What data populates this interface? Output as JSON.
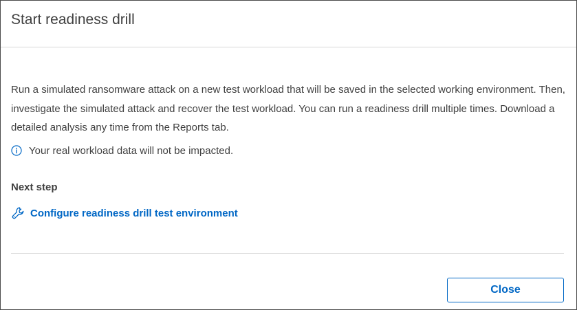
{
  "dialog": {
    "title": "Start readiness drill",
    "description": "Run a simulated ransomware attack on a new test workload that will be saved in the selected working environment. Then, investigate the simulated attack and recover the test workload. You can run a readiness drill multiple times. Download a detailed analysis any time from the Reports tab.",
    "info": {
      "icon": "info-icon",
      "text": "Your real workload data will not be impacted."
    },
    "next_step": {
      "heading": "Next step",
      "link_icon": "wrench-icon",
      "link_text": "Configure readiness drill test environment"
    },
    "footer": {
      "close_label": "Close"
    }
  },
  "colors": {
    "accent": "#0067c5",
    "text": "#404040",
    "divider": "#d6d6d6",
    "border": "#4a4a4a"
  }
}
